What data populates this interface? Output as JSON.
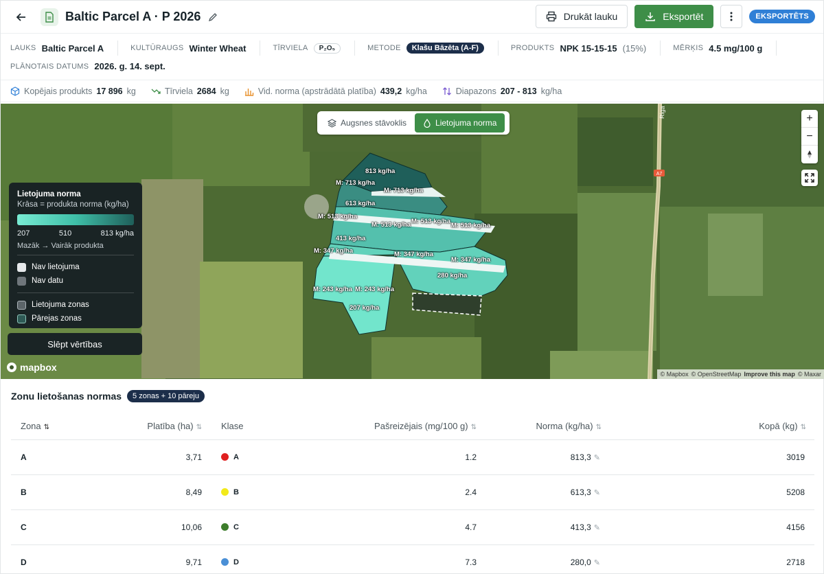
{
  "header": {
    "title": "Baltic Parcel A · P 2026",
    "print_label": "Drukāt lauku",
    "export_label": "Eksportēt",
    "status_badge": "EKSPORTĒTS"
  },
  "info": {
    "field_label": "LAUKS",
    "field_value": "Baltic Parcel A",
    "crop_label": "KULTŪRAUGS",
    "crop_value": "Winter Wheat",
    "nutrient_label": "TĪRVIELA",
    "nutrient_value": "P₂O₅",
    "method_label": "METODE",
    "method_value": "Klašu Bāzēta (A-F)",
    "product_label": "PRODUKTS",
    "product_value": "NPK 15-15-15",
    "product_pct": "(15%)",
    "target_label": "MĒRĶIS",
    "target_value": "4.5 mg/100 g",
    "planned_label": "PLĀNOTAIS DATUMS",
    "planned_value": "2026. g. 14. sept."
  },
  "stats": {
    "total_label": "Kopējais produkts",
    "total_value": "17 896",
    "total_unit": "kg",
    "nutrient_label": "Tīrviela",
    "nutrient_value": "2684",
    "nutrient_unit": "kg",
    "avg_label": "Vid. norma (apstrādātā platība)",
    "avg_value": "439,2",
    "avg_unit": "kg/ha",
    "range_label": "Diapazons",
    "range_value": "207 - 813",
    "range_unit": "kg/ha"
  },
  "map": {
    "tab_soil": "Augsnes stāvoklis",
    "tab_rate": "Lietojuma norma",
    "road_label": "Riga",
    "road_shield": "A7",
    "labels": {
      "l1": "813 kg/ha",
      "l2": "M: 713 kg/ha",
      "l3": "M: 713 kg/ha",
      "l4": "613 kg/ha",
      "l5": "M: 513 kg/ha",
      "l6": "M: 513 kg/ha",
      "l7": "M: 513 kg/ha",
      "l8": "M: 513 kg/ha",
      "l9": "413 kg/ha",
      "l10": "M: 347 kg/ha",
      "l11": "M: 347 kg/ha",
      "l12": "M: 347 kg/ha",
      "l13": "280 kg/ha",
      "l14": "M: 243 kg/ha",
      "l15": "M: 243 kg/ha",
      "l16": "207 kg/ha"
    },
    "legend": {
      "title": "Lietojuma norma",
      "subtitle": "Krāsa = produkta norma (kg/ha)",
      "tick_min": "207",
      "tick_mid": "510",
      "tick_max": "813 kg/ha",
      "note": "Mazāk → Vairāk produkta",
      "items": [
        "Nav lietojuma",
        "Nav datu",
        "Lietojuma zonas",
        "Pārejas zonas"
      ]
    },
    "hide_values": "Slēpt vērtības",
    "mapbox": "mapbox",
    "attribution": [
      "© Mapbox",
      "© OpenStreetMap",
      "Improve this map",
      "© Maxar"
    ]
  },
  "zones": {
    "title": "Zonu lietošanas normas",
    "badge": "5 zonas + 10 pāreju",
    "columns": [
      "Zona",
      "Platība (ha)",
      "Klase",
      "Pašreizējais (mg/100 g)",
      "Norma (kg/ha)",
      "Kopā (kg)"
    ],
    "rows": [
      {
        "zone": "A",
        "area": "3,71",
        "cls": "A",
        "color": "#e02020",
        "current": "1.2",
        "rate": "813,3",
        "total": "3019"
      },
      {
        "zone": "B",
        "area": "8,49",
        "cls": "B",
        "color": "#f2ea1a",
        "current": "2.4",
        "rate": "613,3",
        "total": "5208"
      },
      {
        "zone": "C",
        "area": "10,06",
        "cls": "C",
        "color": "#3d7d2c",
        "current": "4.7",
        "rate": "413,3",
        "total": "4156"
      },
      {
        "zone": "D",
        "area": "9,71",
        "cls": "D",
        "color": "#4a8fd6",
        "current": "7.3",
        "rate": "280,0",
        "total": "2718"
      }
    ]
  }
}
